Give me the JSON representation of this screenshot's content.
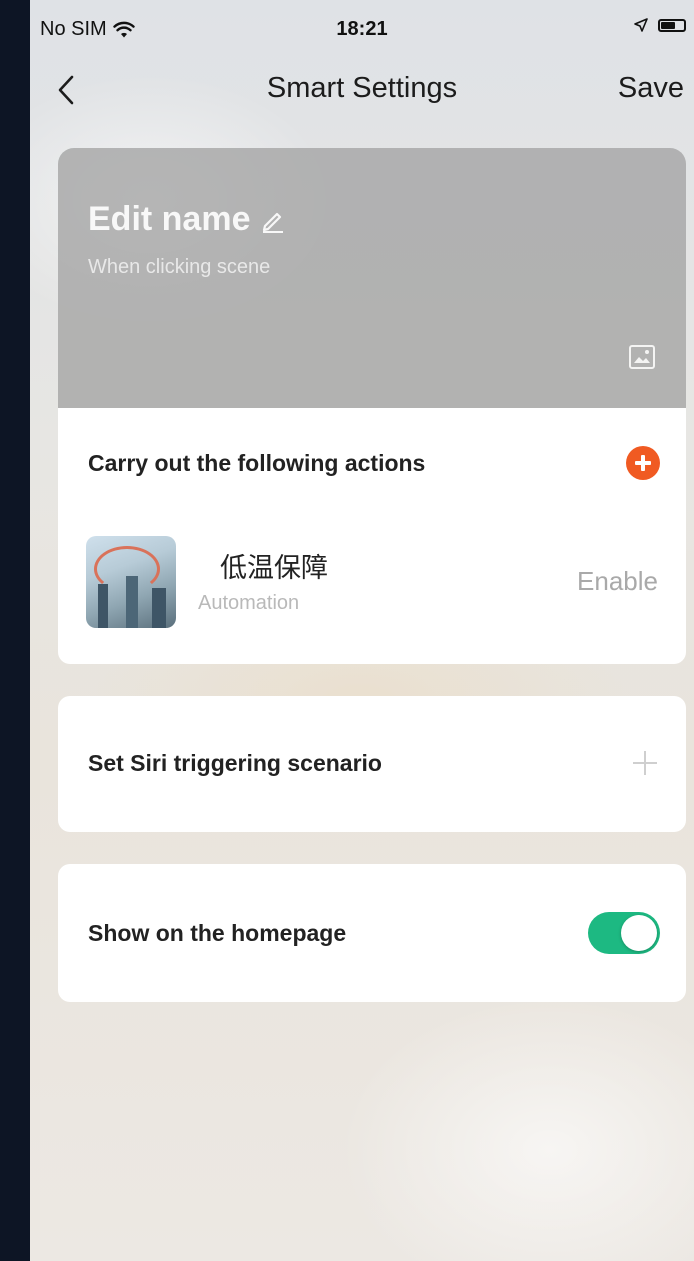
{
  "status_bar": {
    "carrier": "No SIM",
    "time": "18:21",
    "icons": [
      "wifi-icon",
      "location-arrow-icon",
      "battery-icon"
    ]
  },
  "nav": {
    "back_icon": "chevron-left-icon",
    "title": "Smart Settings",
    "save_label": "Save"
  },
  "header": {
    "edit_name_label": "Edit name",
    "edit_icon": "pencil-icon",
    "subtitle": "When clicking  scene",
    "image_icon": "image-icon"
  },
  "actions_section": {
    "title": "Carry out the following actions",
    "add_icon": "plus-circle-icon",
    "accent_color": "#f05a22",
    "items": [
      {
        "name": "低温保障",
        "type": "Automation",
        "status": "Enable"
      }
    ]
  },
  "siri_section": {
    "title": "Set Siri triggering scenario",
    "add_icon": "plus-icon"
  },
  "homepage_section": {
    "title": "Show on the homepage",
    "toggle_on": true,
    "toggle_color": "#1db982"
  }
}
